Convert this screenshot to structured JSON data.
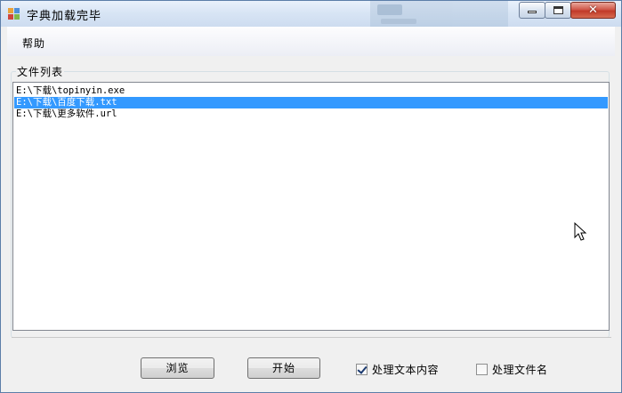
{
  "window": {
    "title": "字典加载完毕",
    "close_glyph": "✕"
  },
  "menu": {
    "help": "帮助"
  },
  "file_list": {
    "group_label": "文件列表",
    "items": [
      "E:\\下载\\topinyin.exe",
      "E:\\下载\\百度下载.txt",
      "E:\\下载\\更多软件.url"
    ],
    "selected_index": 1
  },
  "buttons": {
    "browse": "浏览",
    "start": "开始"
  },
  "options": {
    "process_content": {
      "label": "处理文本内容",
      "checked": true
    },
    "process_filename": {
      "label": "处理文件名",
      "checked": false
    }
  },
  "colors": {
    "selection": "#3399ff",
    "close_button": "#c13a29",
    "titlebar": "#d7e4f4"
  }
}
